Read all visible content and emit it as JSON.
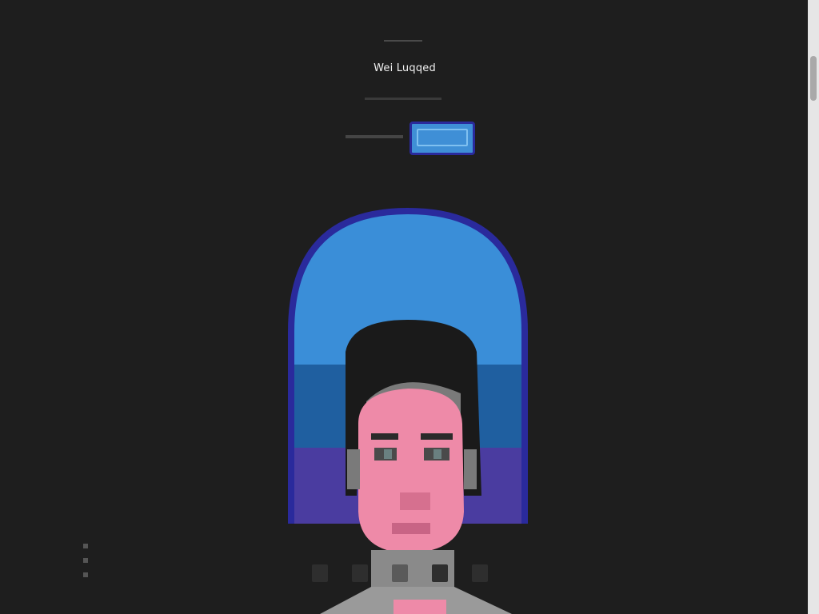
{
  "header": {
    "title": "Wei Luqqed",
    "subtitle": ""
  },
  "action": {
    "label": "",
    "button_label": ""
  },
  "avatar": {
    "description_icon": "avatar-portrait-icon"
  },
  "thumbnails": {
    "count": 5,
    "active_index": 2
  },
  "colors": {
    "background": "#1e1e1e",
    "accent": "#3f8fd6",
    "arch_top": "#3a8ed8",
    "arch_mid": "#1f5fa0",
    "arch_bottom": "#4a3ca0",
    "skin": "#ee8aa8",
    "hair": "#1a1a1a"
  }
}
